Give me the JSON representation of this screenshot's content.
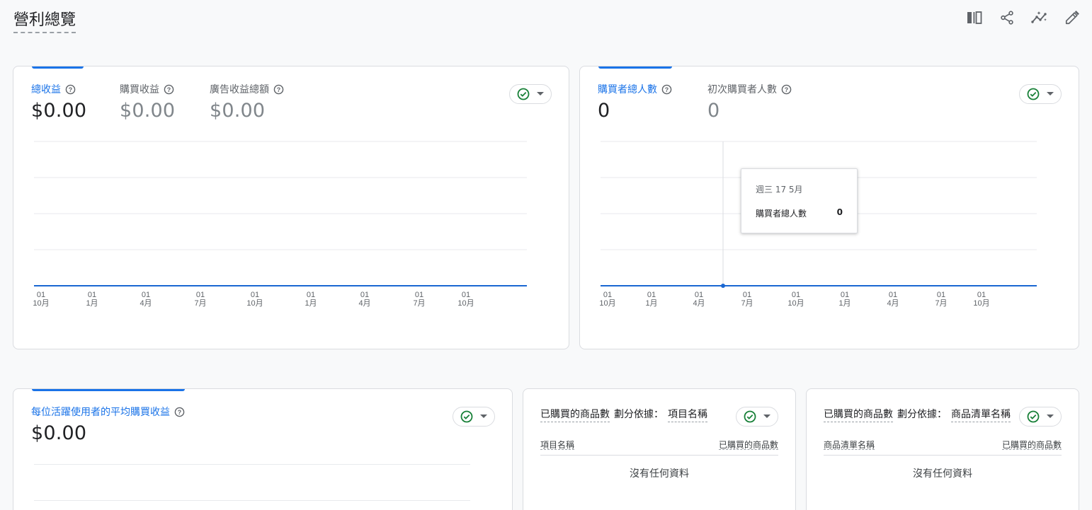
{
  "page": {
    "title": "營利總覽"
  },
  "toolbar": {
    "icons": [
      "compare-icon",
      "share-icon",
      "insights-icon",
      "edit-icon"
    ]
  },
  "colors": {
    "accent": "#1a73e8",
    "success": "#188038",
    "line": "#1967d2"
  },
  "card_revenue": {
    "metrics": [
      {
        "label": "總收益",
        "value": "$0.00"
      },
      {
        "label": "購買收益",
        "value": "$0.00"
      },
      {
        "label": "廣告收益總額",
        "value": "$0.00"
      }
    ],
    "chart_data": {
      "type": "line",
      "x_ticks": [
        [
          "01",
          "10月"
        ],
        [
          "01",
          "1月"
        ],
        [
          "01",
          "4月"
        ],
        [
          "01",
          "7月"
        ],
        [
          "01",
          "10月"
        ],
        [
          "01",
          "1月"
        ],
        [
          "01",
          "4月"
        ],
        [
          "01",
          "7月"
        ],
        [
          "01",
          "10月"
        ]
      ],
      "series": [
        {
          "values": [
            0,
            0,
            0,
            0,
            0,
            0,
            0,
            0,
            0
          ]
        }
      ],
      "grid": true
    }
  },
  "card_purchasers": {
    "metrics": [
      {
        "label": "購買者總人數",
        "value": "0"
      },
      {
        "label": "初次購買者人數",
        "value": "0"
      }
    ],
    "chart_data": {
      "type": "line",
      "x_ticks": [
        [
          "01",
          "10月"
        ],
        [
          "01",
          "1月"
        ],
        [
          "01",
          "4月"
        ],
        [
          "01",
          "7月"
        ],
        [
          "01",
          "10月"
        ],
        [
          "01",
          "1月"
        ],
        [
          "01",
          "4月"
        ],
        [
          "01",
          "7月"
        ],
        [
          "01",
          "10月"
        ]
      ],
      "series": [
        {
          "values": [
            0,
            0,
            0,
            0,
            0,
            0,
            0,
            0,
            0
          ]
        }
      ],
      "grid": true
    },
    "tooltip": {
      "date": "週三 17 5月",
      "metric": "購買者總人數",
      "value": "0"
    }
  },
  "card_arppu": {
    "metric": {
      "label": "每位活躍使用者的平均購買收益",
      "value": "$0.00"
    }
  },
  "card_items": {
    "title_metric": "已購買的商品數",
    "title_by": "劃分依據：",
    "title_dim": "項目名稱",
    "col1": "項目名稱",
    "col2": "已購買的商品數",
    "empty": "沒有任何資料"
  },
  "card_lists": {
    "title_metric": "已購買的商品數",
    "title_by": "劃分依據：",
    "title_dim": "商品清單名稱",
    "col1": "商品清單名稱",
    "col2": "已購買的商品數",
    "empty": "沒有任何資料"
  }
}
